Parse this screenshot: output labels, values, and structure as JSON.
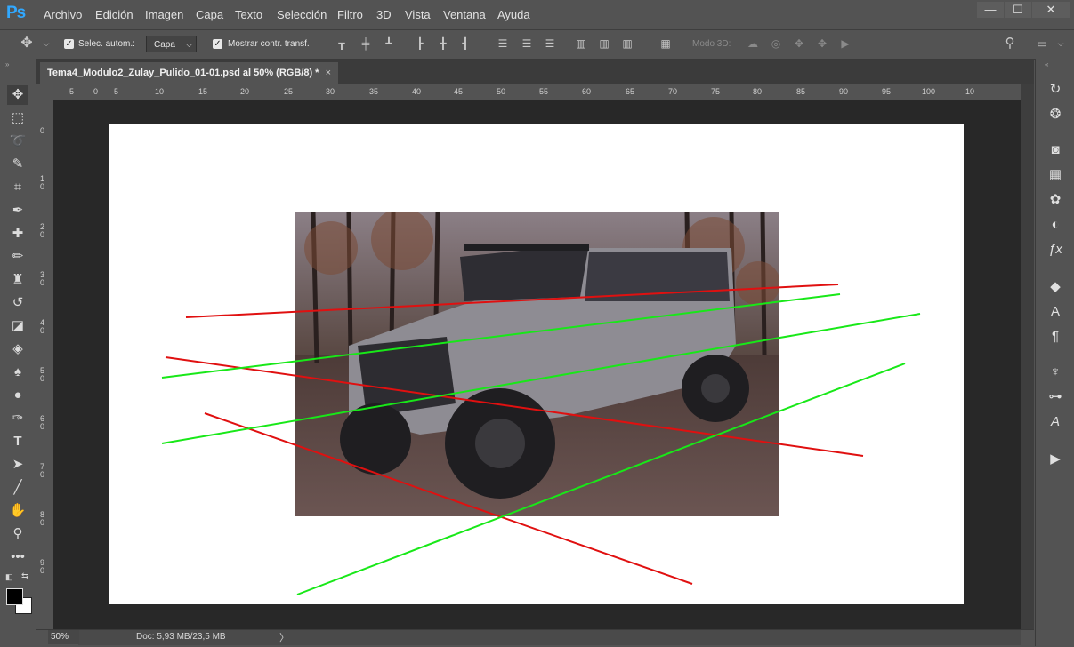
{
  "app": {
    "logo": "Ps"
  },
  "menu": [
    "Archivo",
    "Edición",
    "Imagen",
    "Capa",
    "Texto",
    "Selección",
    "Filtro",
    "3D",
    "Vista",
    "Ventana",
    "Ayuda"
  ],
  "window_controls": {
    "minimize": "—",
    "maximize": "☐",
    "close": "✕"
  },
  "options_bar": {
    "auto_select_label": "Selec. autom.:",
    "auto_select_checked": true,
    "auto_select_target": "Capa",
    "show_transform_label": "Mostrar contr. transf.",
    "show_transform_checked": true,
    "mode_3d_label": "Modo 3D:"
  },
  "document_tab": {
    "title": "Tema4_Modulo2_Zulay_Pulido_01-01.psd al 50% (RGB/8) *",
    "close": "×"
  },
  "ruler_top": [
    "5",
    "0",
    "5",
    "10",
    "15",
    "20",
    "25",
    "30",
    "35",
    "40",
    "45",
    "50",
    "55",
    "60",
    "65",
    "70",
    "75",
    "80",
    "85",
    "90",
    "95",
    "100",
    "10"
  ],
  "ruler_left": [
    "0",
    "1 0",
    "2 0",
    "3 0",
    "4 0",
    "5 0",
    "6 0",
    "7 0",
    "8 0",
    "9 0"
  ],
  "status": {
    "zoom": "50%",
    "doc": "Doc: 5,93 MB/23,5 MB",
    "arrow": "〉"
  },
  "colors": {
    "accent": "#31a8ff",
    "red_line": "#e01010",
    "green_line": "#18e818",
    "canvas": "#ffffff",
    "pasteboard": "#282828"
  },
  "icons": {
    "tools": [
      "move-icon",
      "marquee-icon",
      "lasso-icon",
      "quick-select-icon",
      "crop-icon",
      "eyedropper-icon",
      "healing-icon",
      "brush-icon",
      "stamp-icon",
      "history-brush-icon",
      "eraser-icon",
      "paint-bucket-icon",
      "blur-icon",
      "dodge-icon",
      "pen-icon",
      "type-icon",
      "path-select-icon",
      "line-icon",
      "hand-icon",
      "zoom-icon",
      "more-tools-icon"
    ],
    "panels": [
      "history-icon",
      "color-icon",
      "properties-icon",
      "swatches-icon",
      "styles-icon",
      "adjustments-icon",
      "fx-icon",
      "layers-icon",
      "character-icon",
      "paragraph-icon",
      "brushes-icon",
      "channels-icon",
      "glyphs-icon",
      "play-icon"
    ]
  }
}
